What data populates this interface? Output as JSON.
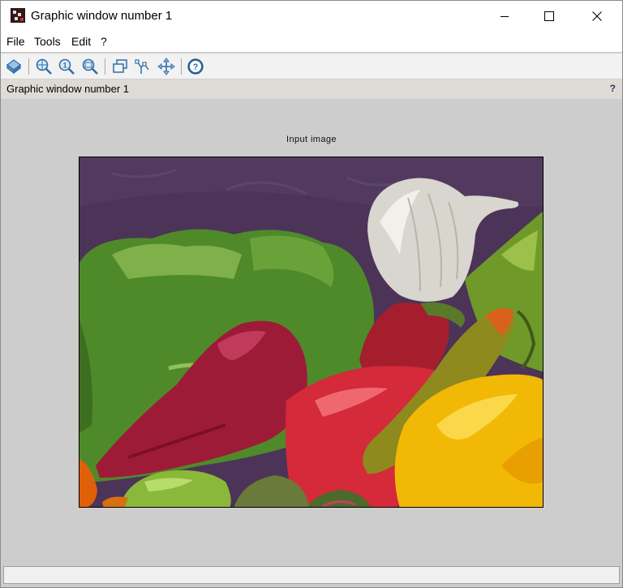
{
  "window": {
    "title": "Graphic window number 1"
  },
  "menu": [
    "File",
    "Tools",
    "Edit",
    "?"
  ],
  "toolbar": {
    "icons": [
      "rotate-icon",
      "zoom-icon",
      "zoom-reset-icon",
      "zoom-out-icon",
      "window-copy-icon",
      "datatip-icon",
      "pan-icon",
      "help-icon"
    ]
  },
  "infobar": {
    "text": "Graphic window number 1",
    "help": "?"
  },
  "figure": {
    "axes_title": "Input image"
  },
  "colors": {
    "background": "#cdcdcd",
    "infobar": "#dddbd6",
    "toolbar_icon": "#2e6ea8"
  }
}
